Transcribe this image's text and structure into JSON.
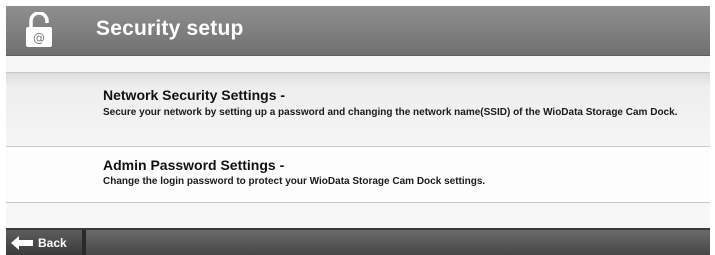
{
  "header": {
    "title": "Security setup",
    "icon": "unlocked-padlock-icon"
  },
  "items": [
    {
      "title": "Network Security Settings -",
      "description": "Secure your network by setting up a password and changing the network name(SSID) of the WioData Storage Cam Dock."
    },
    {
      "title": "Admin Password Settings -",
      "description": "Change the login password to protect your WioData Storage Cam Dock settings."
    }
  ],
  "footer": {
    "back_label": "Back",
    "back_icon": "left-arrow-icon"
  },
  "colors": {
    "header_bg": "#7f7f7f",
    "footer_bg": "#555555",
    "text": "#111111"
  }
}
